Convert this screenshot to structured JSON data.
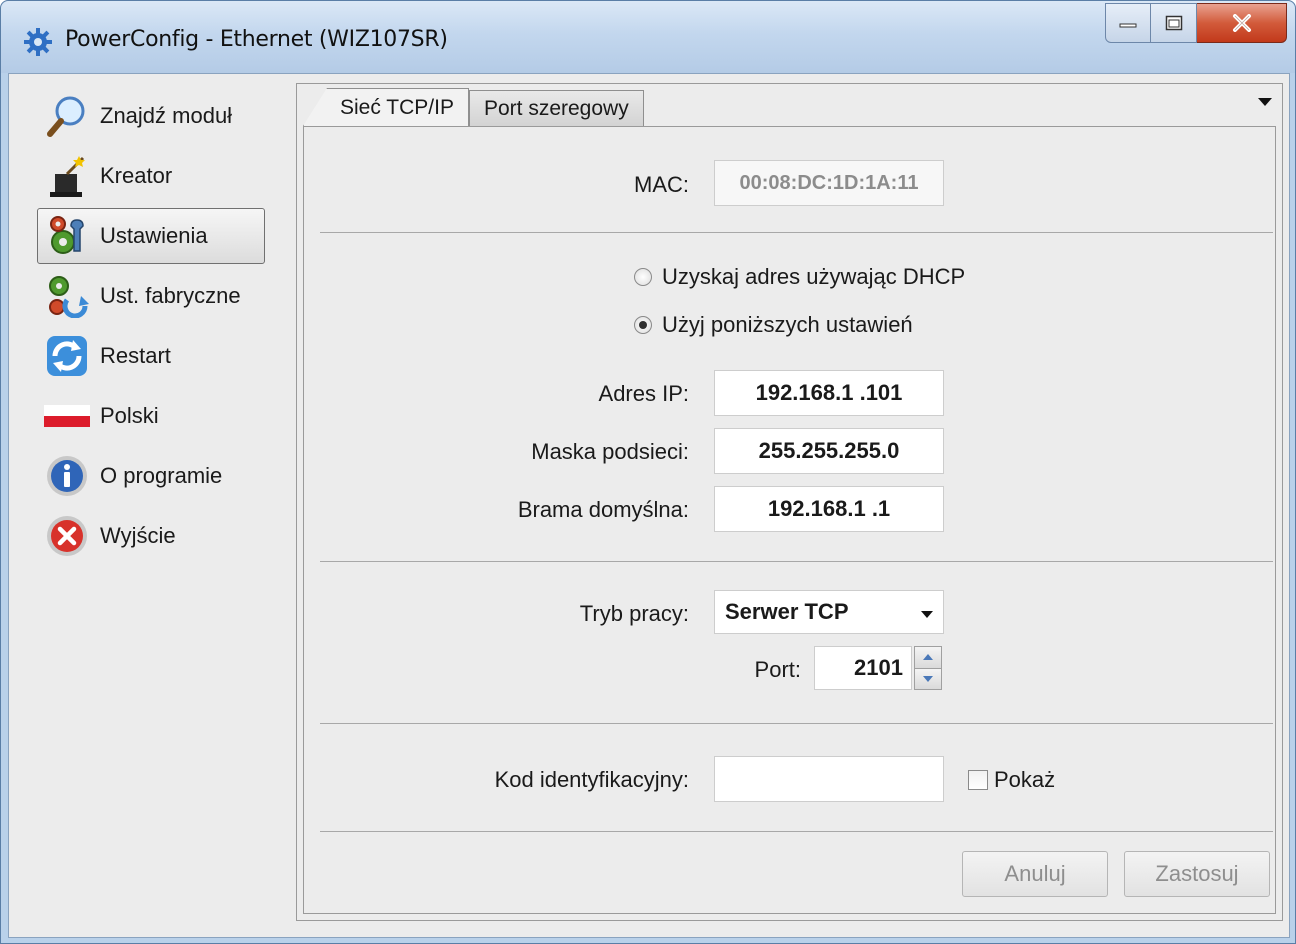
{
  "window": {
    "title": "PowerConfig - Ethernet (WIZ107SR)"
  },
  "sidebar": {
    "items": [
      {
        "label": "Znajdź moduł",
        "icon": "magnifier-icon"
      },
      {
        "label": "Kreator",
        "icon": "magic-hat-icon"
      },
      {
        "label": "Ustawienia",
        "icon": "gears-wrench-icon",
        "active": true
      },
      {
        "label": "Ust. fabryczne",
        "icon": "gears-reset-icon"
      },
      {
        "label": "Restart",
        "icon": "refresh-icon"
      },
      {
        "label": "Polski",
        "icon": "polish-flag-icon"
      },
      {
        "label": "O programie",
        "icon": "info-icon"
      },
      {
        "label": "Wyjście",
        "icon": "exit-icon"
      }
    ]
  },
  "tabs": [
    {
      "label": "Sieć TCP/IP",
      "active": true
    },
    {
      "label": "Port szeregowy",
      "active": false
    }
  ],
  "form": {
    "mac_label": "MAC:",
    "mac_value": "00:08:DC:1D:1A:11",
    "dhcp_label": "Uzyskaj adres używając DHCP",
    "static_label": "Użyj poniższych ustawień",
    "ip_label": "Adres IP:",
    "ip_value": "192.168.1  .101",
    "mask_label": "Maska podsieci:",
    "mask_value": "255.255.255.0",
    "gateway_label": "Brama domyślna:",
    "gateway_value": "192.168.1  .1",
    "mode_label": "Tryb pracy:",
    "mode_value": "Serwer TCP",
    "port_label": "Port:",
    "port_value": "2101",
    "code_label": "Kod identyfikacyjny:",
    "code_value": "",
    "show_label": "Pokaż"
  },
  "buttons": {
    "cancel": "Anuluj",
    "apply": "Zastosuj"
  },
  "colors": {
    "titlebar": "#c3d7ee",
    "close_button": "#c94a2b",
    "panel_bg": "#ececec"
  }
}
